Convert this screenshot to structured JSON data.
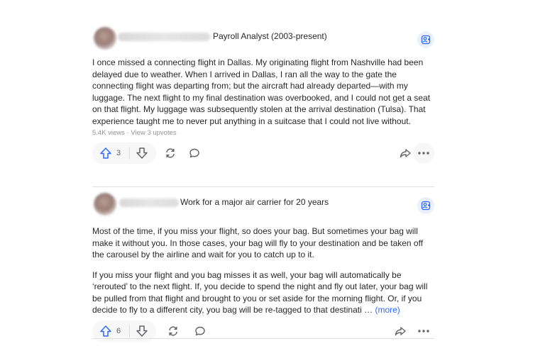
{
  "answers": [
    {
      "credential": "Payroll Analyst (2003-present)",
      "paragraphs": [
        "I once missed a connecting flight in Dallas. My originating flight from Nashville had been delayed due to weather. When I arrived in Dallas, I ran all the way to the gate the connecting flight was departing from; but the aircraft had already departed—with my luggage. The next flight to my final destination was overbooked, and I could not get a seat on that flight. My luggage was subsequently stolen at the arrival destination (Tulsa). That experience taught me to never put anything in a suitcase that I could not live without."
      ],
      "meta": "5.4K views · View 3 upvotes",
      "upvotes": "3"
    },
    {
      "credential": "Work for a major air carrier for 20 years",
      "paragraphs": [
        "Most of the time, if you miss your flight, so does your bag. But sometimes your bag will make it without you. In those cases, your bag will fly to your destination and be taken off the carousel by the airline and wait for you to catch up to it.",
        "If you miss your flight and you bag misses it as well, your bag will automatically be ‘rerouted’ to the next flight. If, you decide to spend the night and fly out later, your bag will be pulled from that flight and brought to you or set aside for the morning flight. Or, if you decide to fly to a different city, you bag will be re-tagged to that destinati …"
      ],
      "more_label": "(more)",
      "upvotes": "6"
    }
  ],
  "icons": {
    "follow": "follow-user-icon",
    "upvote": "upvote-arrow-icon",
    "downvote": "downvote-arrow-icon",
    "share_reload": "reshare-icon",
    "comment": "comment-bubble-icon",
    "share": "share-arrow-icon",
    "more": "more-dots-icon"
  },
  "colors": {
    "accent": "#2e69ff",
    "text": "#282829",
    "muted": "#939598",
    "icon": "#636466"
  }
}
